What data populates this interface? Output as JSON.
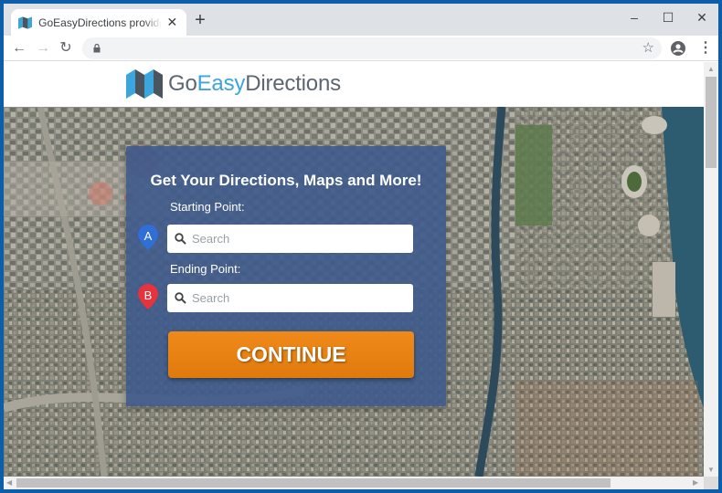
{
  "browser": {
    "tab": {
      "title": "GoEasyDirections provides you with",
      "favicon": "map-fold-icon"
    },
    "controls": {
      "new_tab": "+",
      "minimize": "–",
      "maximize": "☐",
      "close": "✕"
    },
    "toolbar": {
      "back": "←",
      "forward": "→",
      "reload": "↻",
      "url": "",
      "bookmark": "☆",
      "menu": "⋮"
    }
  },
  "page": {
    "logo": {
      "part1": "Go",
      "part2": "Easy",
      "part3": "Directions",
      "colors": {
        "gray": "#5d6670",
        "blue": "#3ba5dc"
      }
    },
    "form": {
      "title": "Get Your Directions, Maps and More!",
      "start_label": "Starting Point:",
      "start_marker": "A",
      "start_placeholder": "Search",
      "end_label": "Ending Point:",
      "end_marker": "B",
      "end_placeholder": "Search",
      "submit_label": "CONTINUE",
      "colors": {
        "panel": "#3e5a8c",
        "button": "#e8820f",
        "marker_a": "#2f6fd6",
        "marker_b": "#e8323c"
      }
    },
    "background": "satellite-city-map"
  }
}
